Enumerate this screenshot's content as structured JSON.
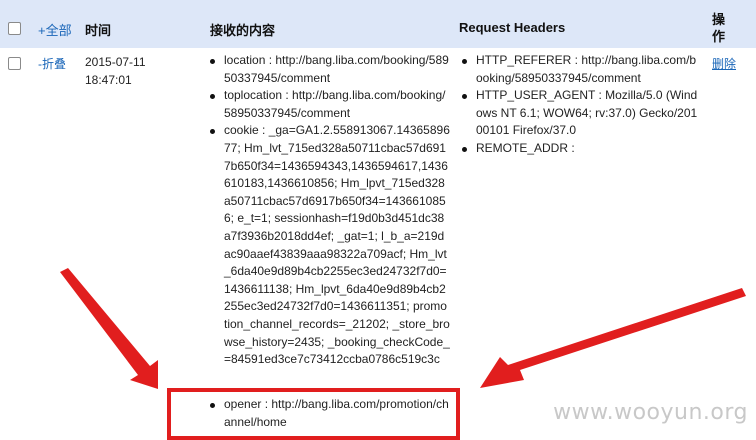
{
  "header": {
    "expand_all": "+全部",
    "time": "时间",
    "received_content": "接收的内容",
    "request_headers": "Request Headers",
    "action": "操作"
  },
  "row": {
    "collapse": "-折叠",
    "date": "2015-07-11",
    "time": "18:47:01",
    "content": {
      "location": "location : http://bang.liba.com/booking/58950337945/comment",
      "toplocation": "toplocation : http://bang.liba.com/booking/58950337945/comment",
      "cookie": "cookie : _ga=GA1.2.558913067.1436589677; Hm_lvt_715ed328a50711cbac57d6917b650f34=1436594343,1436594617,1436610183,1436610856; Hm_lpvt_715ed328a50711cbac57d6917b650f34=1436610856; e_t=1; sessionhash=f19d0b3d451dc38a7f3936b2018dd4ef; _gat=1; l_b_a=219dac90aaef43839aaa98322a709acf; Hm_lvt_6da40e9d89b4cb2255ec3ed24732f7d0=1436611138; Hm_lpvt_6da40e9d89b4cb2255ec3ed24732f7d0=1436611351; promotion_channel_records=_21202; _store_browse_history=2435; _booking_checkCode_=84591ed3ce7c73412ccba0786c519c3c",
      "opener": "opener : http://bang.liba.com/promotion/channel/home"
    },
    "headers": {
      "referer": "HTTP_REFERER : http://bang.liba.com/booking/58950337945/comment",
      "user_agent": "HTTP_USER_AGENT : Mozilla/5.0 (Windows NT 6.1; WOW64; rv:37.0) Gecko/20100101 Firefox/37.0",
      "remote_addr": "REMOTE_ADDR :"
    },
    "delete": "删除"
  },
  "watermark": "www.wooyun.org",
  "colors": {
    "header_bg": "#dde7f8",
    "link": "#1a66b8",
    "highlight": "#e11e1e"
  }
}
